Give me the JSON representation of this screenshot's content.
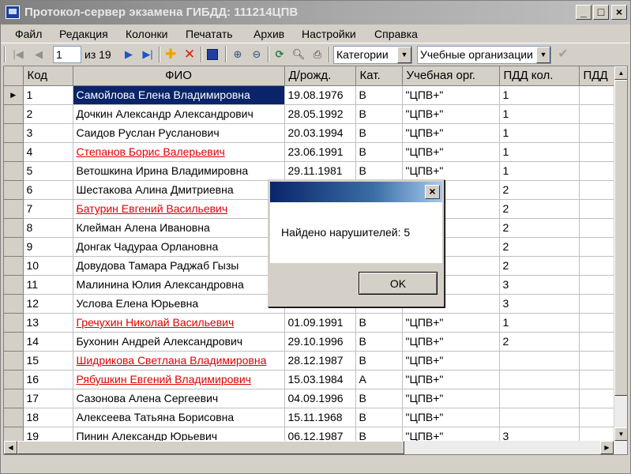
{
  "window": {
    "title": "Протокол-сервер экзамена ГИБДД: 111214ЦПВ",
    "minimize": "_",
    "maximize": "□",
    "close": "×"
  },
  "menu": [
    "Файл",
    "Редакция",
    "Колонки",
    "Печатать",
    "Архив",
    "Настройки",
    "Справка"
  ],
  "toolbar": {
    "page_value": "1",
    "page_of": "из 19",
    "category_combo": "Категории",
    "org_combo": "Учебные организации"
  },
  "grid": {
    "columns": [
      "Код",
      "ФИО",
      "Д/рожд.",
      "Кат.",
      "Учебная орг.",
      "ПДД кол.",
      "ПДД"
    ],
    "rows": [
      {
        "kod": "1",
        "fio": "Самойлова Елена Владимировна",
        "dob": "19.08.1976",
        "cat": "B",
        "org": "\"ЦПВ+\"",
        "pdd": "1",
        "violator": false,
        "selected": true
      },
      {
        "kod": "2",
        "fio": "Дочкин Александр Александрович",
        "dob": "28.05.1992",
        "cat": "B",
        "org": "\"ЦПВ+\"",
        "pdd": "1",
        "violator": false
      },
      {
        "kod": "3",
        "fio": "Саидов Руслан Русланович",
        "dob": "20.03.1994",
        "cat": "B",
        "org": "\"ЦПВ+\"",
        "pdd": "1",
        "violator": false
      },
      {
        "kod": "4",
        "fio": "Степанов Борис Валерьевич",
        "dob": "23.06.1991",
        "cat": "B",
        "org": "\"ЦПВ+\"",
        "pdd": "1",
        "violator": true
      },
      {
        "kod": "5",
        "fio": "Ветошкина Ирина Владимировна",
        "dob": "29.11.1981",
        "cat": "B",
        "org": "\"ЦПВ+\"",
        "pdd": "1",
        "violator": false
      },
      {
        "kod": "6",
        "fio": "Шестакова Алина Дмитриевна",
        "dob": "",
        "cat": "",
        "org": "",
        "pdd": "2",
        "violator": false
      },
      {
        "kod": "7",
        "fio": "Батурин Евгений Васильевич",
        "dob": "",
        "cat": "",
        "org": "",
        "pdd": "2",
        "violator": true
      },
      {
        "kod": "8",
        "fio": "Клейман Алена Ивановна",
        "dob": "",
        "cat": "",
        "org": "",
        "pdd": "2",
        "violator": false
      },
      {
        "kod": "9",
        "fio": "Донгак Чадураа Орлановна",
        "dob": "",
        "cat": "",
        "org": "",
        "pdd": "2",
        "violator": false
      },
      {
        "kod": "10",
        "fio": "Довудова Тамара Раджаб Гызы",
        "dob": "",
        "cat": "",
        "org": "",
        "pdd": "2",
        "violator": false
      },
      {
        "kod": "11",
        "fio": "Малинина Юлия Александровна",
        "dob": "",
        "cat": "",
        "org": "",
        "pdd": "3",
        "violator": false
      },
      {
        "kod": "12",
        "fio": "Услова Елена Юрьевна",
        "dob": "",
        "cat": "",
        "org": "",
        "pdd": "3",
        "violator": false
      },
      {
        "kod": "13",
        "fio": "Гречухин Николай Васильевич",
        "dob": "01.09.1991",
        "cat": "B",
        "org": "\"ЦПВ+\"",
        "pdd": "1",
        "violator": true
      },
      {
        "kod": "14",
        "fio": "Бухонин Андрей Александрович",
        "dob": "29.10.1996",
        "cat": "B",
        "org": "\"ЦПВ+\"",
        "pdd": "2",
        "violator": false
      },
      {
        "kod": "15",
        "fio": "Шидрикова Светлана Владимировна",
        "dob": "28.12.1987",
        "cat": "B",
        "org": "\"ЦПВ+\"",
        "pdd": "",
        "violator": true
      },
      {
        "kod": "16",
        "fio": "Рябушкин Евгений Владимирович",
        "dob": "15.03.1984",
        "cat": "A",
        "org": "\"ЦПВ+\"",
        "pdd": "",
        "violator": true
      },
      {
        "kod": "17",
        "fio": "Сазонова Алена Сергеевич",
        "dob": "04.09.1996",
        "cat": "B",
        "org": "\"ЦПВ+\"",
        "pdd": "",
        "violator": false
      },
      {
        "kod": "18",
        "fio": "Алексеева Татьяна Борисовна",
        "dob": "15.11.1968",
        "cat": "B",
        "org": "\"ЦПВ+\"",
        "pdd": "",
        "violator": false
      },
      {
        "kod": "19",
        "fio": "Пинин Александр Юрьевич",
        "dob": "06.12.1987",
        "cat": "B",
        "org": "\"ЦПВ+\"",
        "pdd": "3",
        "violator": false
      }
    ]
  },
  "dialog": {
    "close": "×",
    "message": "Найдено нарушителей: 5",
    "ok": "OK"
  },
  "icons": {
    "first": "first-record-icon",
    "prev": "prev-record-icon",
    "next": "next-record-icon",
    "last": "last-record-icon",
    "add": "add-icon",
    "delete": "delete-icon",
    "save": "save-icon",
    "zoom_in": "zoom-in-icon",
    "zoom_out": "zoom-out-icon",
    "refresh": "refresh-icon",
    "preview": "print-preview-icon",
    "print": "print-icon",
    "apply": "checkmark-icon"
  }
}
